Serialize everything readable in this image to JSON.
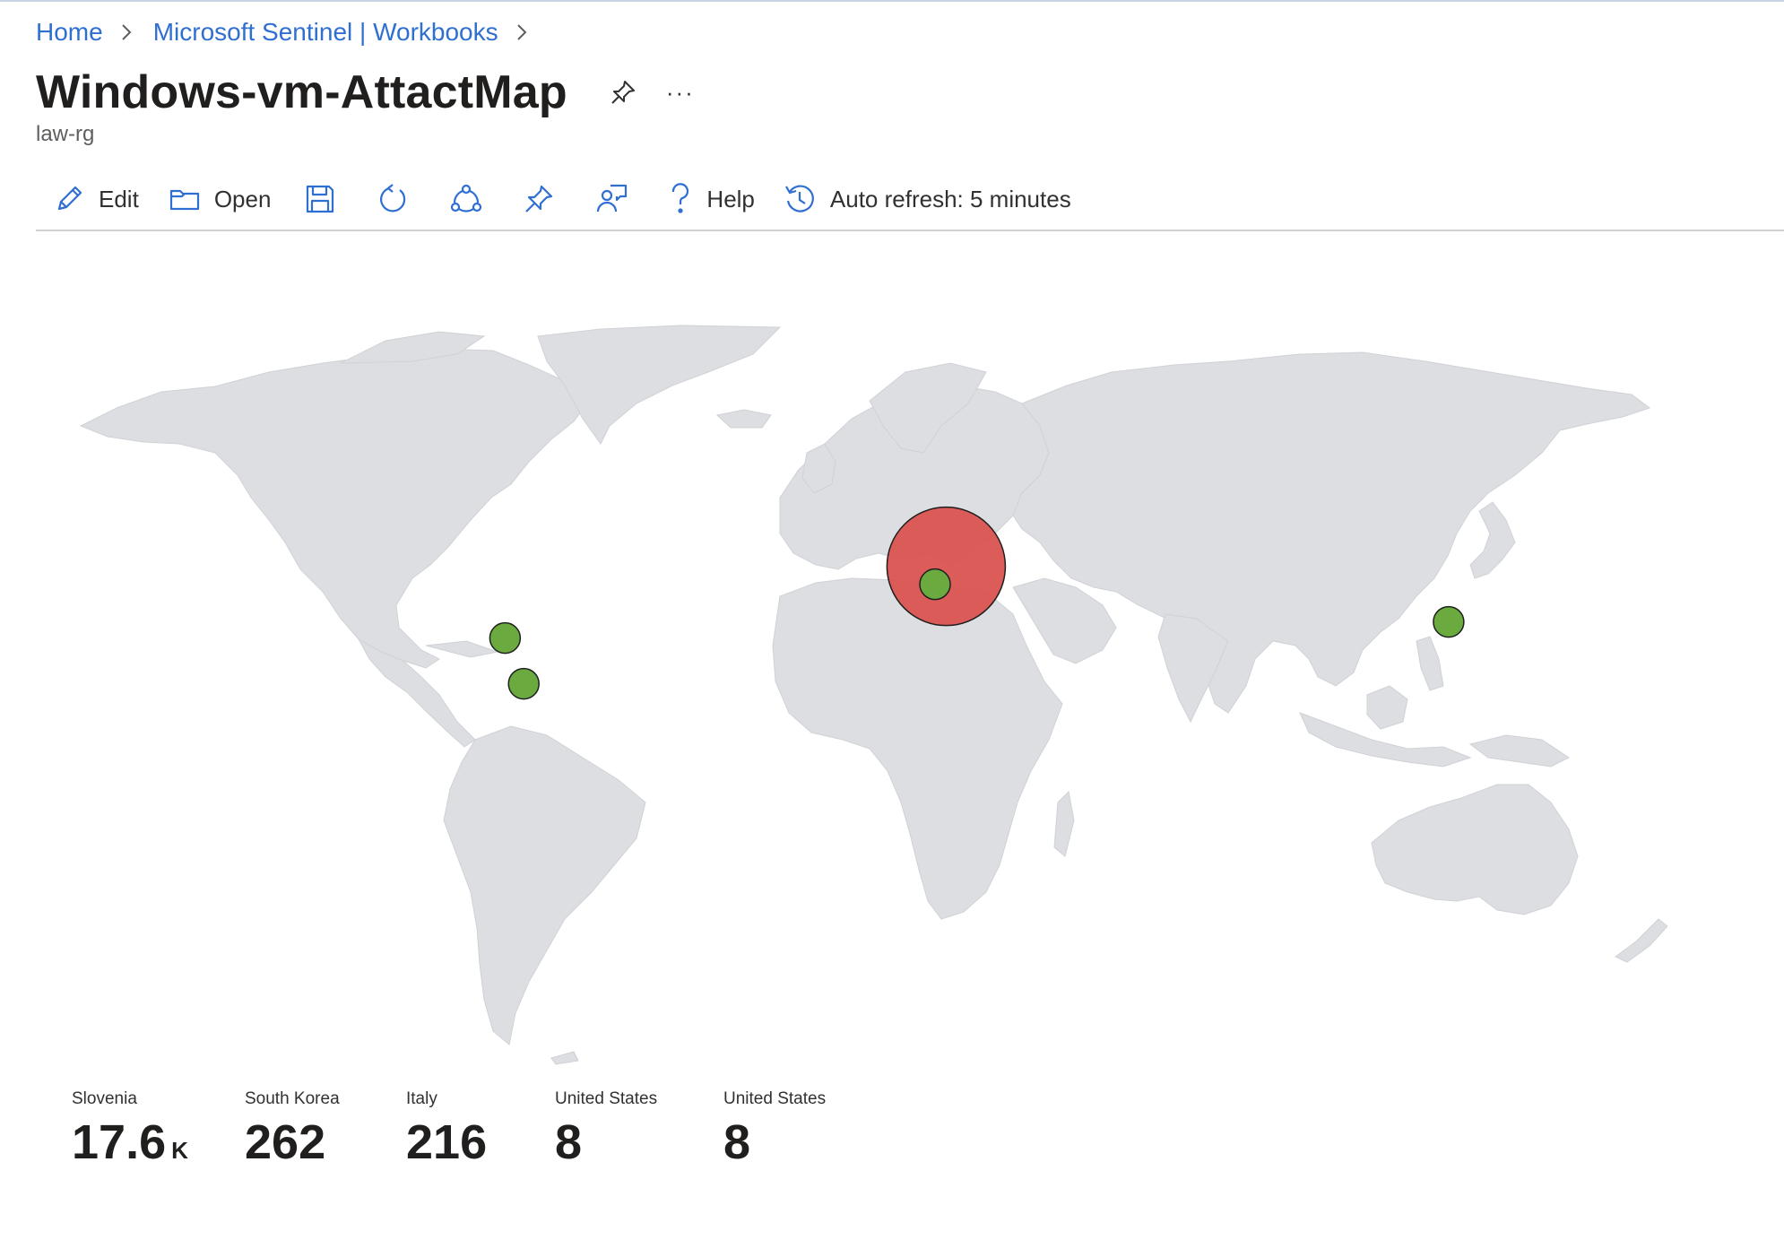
{
  "breadcrumb": {
    "items": [
      "Home",
      "Microsoft Sentinel | Workbooks"
    ]
  },
  "header": {
    "title": "Windows-vm-AttactMap",
    "subtitle": "law-rg",
    "more": "···"
  },
  "toolbar": {
    "edit": "Edit",
    "open": "Open",
    "help": "Help",
    "auto_refresh": "Auto refresh: 5 minutes"
  },
  "colors": {
    "accent": "#2f6fd1",
    "land": "#dcdee1",
    "bubble_high": "#d9534f",
    "bubble_low": "#6aaa3f"
  },
  "map": {
    "bubbles": [
      {
        "country": "Slovenia",
        "lat": 46.1,
        "lon": 14.8,
        "value": 17600,
        "level": "high"
      },
      {
        "country": "Italy",
        "lat": 43.0,
        "lon": 12.3,
        "value": 216,
        "level": "low"
      },
      {
        "country": "South Korea",
        "lat": 36.5,
        "lon": 127.8,
        "value": 262,
        "level": "low"
      },
      {
        "country": "United States",
        "lat": 33.7,
        "lon": -84.4,
        "value": 8,
        "level": "low"
      },
      {
        "country": "United States",
        "lat": 25.8,
        "lon": -80.2,
        "value": 8,
        "level": "low"
      }
    ]
  },
  "tiles": [
    {
      "label": "Slovenia",
      "value": "17.6",
      "unit": "K"
    },
    {
      "label": "South Korea",
      "value": "262",
      "unit": ""
    },
    {
      "label": "Italy",
      "value": "216",
      "unit": ""
    },
    {
      "label": "United States",
      "value": "8",
      "unit": ""
    },
    {
      "label": "United States",
      "value": "8",
      "unit": ""
    }
  ]
}
